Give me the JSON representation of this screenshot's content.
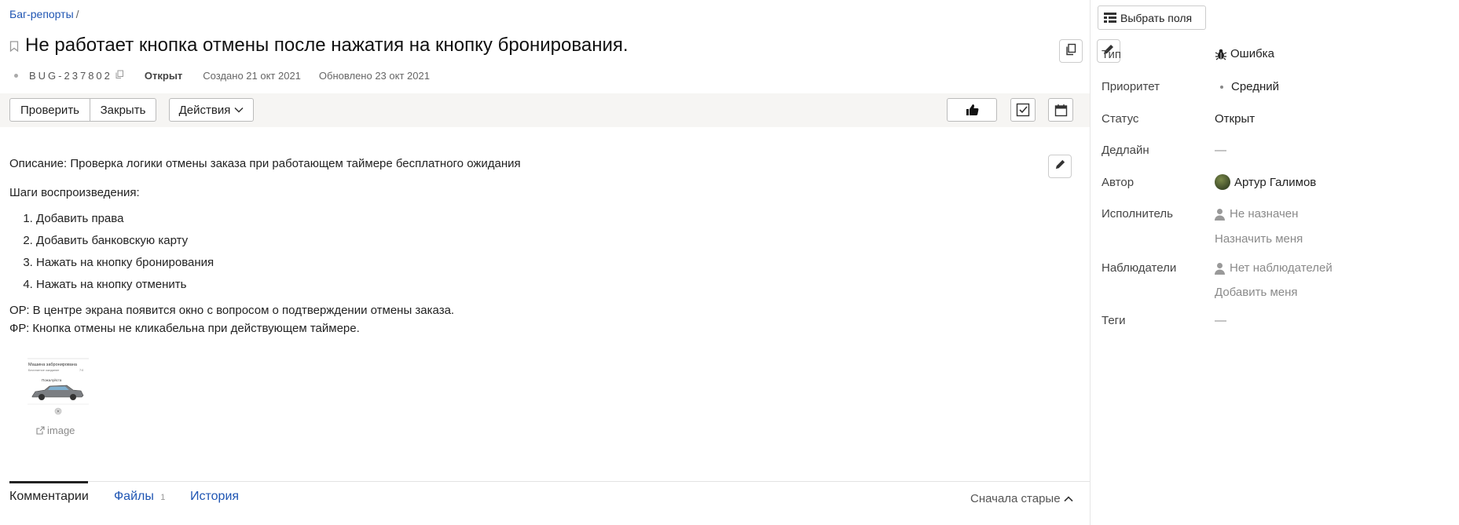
{
  "breadcrumb": {
    "link": "Баг-репорты",
    "sep": "/"
  },
  "issue": {
    "title": "Не работает кнопка отмены после нажатия на кнопку бронирования.",
    "key": "BUG-237802",
    "status": "Открыт",
    "created": "Создано 21 окт 2021",
    "updated": "Обновлено 23 окт 2021"
  },
  "toolbar": {
    "check": "Проверить",
    "close": "Закрыть",
    "actions": "Действия"
  },
  "description": {
    "intro": "Описание: Проверка логики отмены заказа при работающем таймере бесплатного ожидания",
    "steps_title": "Шаги воспроизведения:",
    "steps": [
      "Добавить права",
      "Добавить банковскую карту",
      "Нажать на кнопку бронирования",
      "Нажать на кнопку отменить"
    ],
    "expected": "ОР: В центре экрана появится окно с вопросом о подтверждении отмены заказа.",
    "actual": "ФР: Кнопка отмены не кликабельна при действующем таймере.",
    "image_caption": "image",
    "thumb_title": "Машина забронирована",
    "thumb_sub": "Бесплатное ожидание",
    "thumb_time": "7:0",
    "thumb_label": "Пожалуйста"
  },
  "tabs": {
    "comments": "Комментарии",
    "files": "Файлы",
    "files_count": "1",
    "history": "История",
    "sort": "Сначала старые"
  },
  "sidebar": {
    "select_fields": "Выбрать поля",
    "type_label": "Тип",
    "type_value": "Ошибка",
    "priority_label": "Приоритет",
    "priority_value": "Средний",
    "status_label": "Статус",
    "status_value": "Открыт",
    "deadline_label": "Дедлайн",
    "deadline_value": "—",
    "author_label": "Автор",
    "author_value": "Артур Галимов",
    "assignee_label": "Исполнитель",
    "assignee_value": "Не назначен",
    "assign_me": "Назначить меня",
    "watchers_label": "Наблюдатели",
    "watchers_value": "Нет наблюдателей",
    "add_me": "Добавить меня",
    "tags_label": "Теги",
    "tags_value": "—"
  },
  "icons": [
    "bookmark-icon",
    "copy-icon",
    "edit-icon",
    "thumbs-up-icon",
    "checklist-icon",
    "calendar-icon",
    "bug-icon",
    "person-icon",
    "external-link-icon",
    "chevron-up-icon",
    "chevron-down-icon",
    "columns-icon"
  ]
}
